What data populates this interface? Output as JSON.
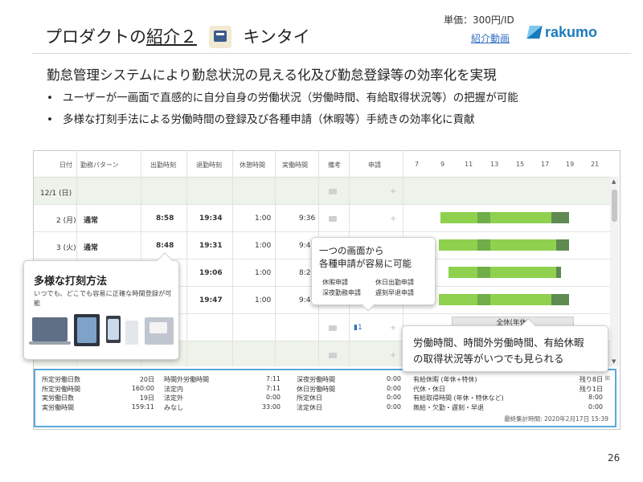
{
  "slide": {
    "title_prefix": "プロダクトの",
    "title_underlined": "紹介２",
    "title_suffix": "キンタイ",
    "title_icon_name": "kintai-app-icon",
    "price": "単価：300円/ID",
    "video_link": "紹介動画",
    "logo_text": "rakumo",
    "headline": "勤怠管理システムにより勤怠状況の見える化及び勤怠登録等の効率化を実現",
    "bullets": [
      "ユーザーが一画面で直感的に自分自身の労働状況（労働時間、有給取得状況等）の把握が可能",
      "多様な打刻手法による労働時間の登録及び各種申請（休暇等）手続きの効率化に貢献"
    ],
    "page_number": "26"
  },
  "screenshot": {
    "headers": {
      "date": "日付",
      "pattern": "勤務パターン",
      "clock_in": "出勤時刻",
      "clock_out": "退勤時刻",
      "break": "休憩時間",
      "actual": "実働時間",
      "note": "備考",
      "request": "申請",
      "hours": [
        "7",
        "9",
        "11",
        "13",
        "15",
        "17",
        "19",
        "21"
      ]
    },
    "rows": [
      {
        "date": "12/1 (日)",
        "pattern": "",
        "in": "",
        "out": "",
        "break": "",
        "actual": ""
      },
      {
        "date": "2 (月)",
        "pattern": "通常",
        "in": "8:58",
        "out": "19:34",
        "break": "1:00",
        "actual": "9:36"
      },
      {
        "date": "3 (火)",
        "pattern": "通常",
        "in": "8:48",
        "out": "19:31",
        "break": "1:00",
        "actual": "9:43"
      },
      {
        "date": "",
        "pattern": "",
        "in": "",
        "out": "19:06",
        "break": "1:00",
        "actual": "8:25"
      },
      {
        "date": "",
        "pattern": "",
        "in": "",
        "out": "19:47",
        "break": "1:00",
        "actual": "9:46"
      },
      {
        "date": "",
        "pattern": "",
        "in": "",
        "out": "",
        "break": "",
        "actual": ""
      },
      {
        "date": "",
        "pattern": "",
        "in": "",
        "out": "",
        "break": "",
        "actual": ""
      }
    ],
    "request_count": "1",
    "zenkyu_label": "全休(年休)",
    "colors": {
      "bar_light": "#8fd14f",
      "bar_mid": "#6fae4a",
      "bar_dark": "#5f8a52",
      "weekend_bg": "#edf3ea",
      "summary_border": "#5aa9db"
    },
    "summary": {
      "col1": [
        {
          "label": "所定労働日数",
          "value": "20日"
        },
        {
          "label": "所定労働時間",
          "value": "160:00"
        },
        {
          "label": "実労働日数",
          "value": "19日"
        },
        {
          "label": "実労働時間",
          "value": "159:11"
        }
      ],
      "col2": [
        {
          "label": "時間外労働時間",
          "value": "7:11"
        },
        {
          "label": "法定内",
          "value": "7:11"
        },
        {
          "label": "法定外",
          "value": "0:00"
        },
        {
          "label": "みなし",
          "value": "33:00"
        }
      ],
      "col3": [
        {
          "label": "深夜労働時間",
          "value": "0:00"
        },
        {
          "label": "休日労働時間",
          "value": "0:00"
        },
        {
          "label": "所定休日",
          "value": "0:00"
        },
        {
          "label": "法定休日",
          "value": "0:00"
        }
      ],
      "col4": [
        {
          "label": "有給休暇 (年休+特休)",
          "value": "残り8日"
        },
        {
          "label": "代休・休日",
          "value": "残り1日"
        },
        {
          "label": "有給取得時間 (年休・特休など)",
          "value": "8:00"
        },
        {
          "label": "無給・欠勤・遅刻・早退",
          "value": "0:00"
        }
      ],
      "footnote": "最終集計時間: 2020年2月17日 15:39"
    }
  },
  "callouts": {
    "stamping": {
      "title": "多様な打刻方法",
      "text": "いつでも、どこでも容易に正確な時間登録が可能"
    },
    "requests": {
      "line1": "一つの画面から",
      "line2": "各種申請が容易に可能",
      "items": [
        "休暇申請",
        "休日出勤申請",
        "深夜勤務申請",
        "遅刻早退申請"
      ]
    },
    "status": {
      "line1": "労働時間、時間外労働時間、有給休暇",
      "line2": "の取得状況等がいつでも見られる"
    }
  }
}
